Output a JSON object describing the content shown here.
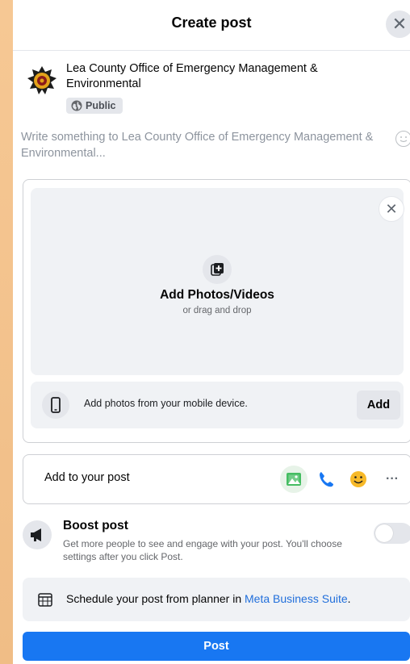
{
  "header": {
    "title": "Create post",
    "close_glyph": "✕"
  },
  "author": {
    "name": "Lea County Office of Emergency Management & Environmental",
    "privacy": "Public"
  },
  "composer": {
    "placeholder": "Write something to Lea County Office of Emergency Management & Environmental..."
  },
  "media": {
    "close_glyph": "✕",
    "title": "Add Photos/Videos",
    "subtitle": "or drag and drop",
    "mobile_text": "Add photos from your mobile device.",
    "add_label": "Add"
  },
  "add_to_post": {
    "label": "Add to your post",
    "more_glyph": "···",
    "tools": [
      "photo-video-icon",
      "phone-icon",
      "feeling-icon",
      "more-icon"
    ]
  },
  "boost": {
    "title": "Boost post",
    "description": "Get more people to see and engage with your post. You'll choose settings after you click Post.",
    "enabled": false
  },
  "schedule": {
    "text": "Schedule your post from planner in ",
    "link": "Meta Business Suite",
    "suffix": "."
  },
  "post_button": {
    "label": "Post"
  },
  "colors": {
    "primary": "#1877f2",
    "link": "#216fdb",
    "photo_green": "#45bd62",
    "feeling_yellow": "#f7b928",
    "background_frame": "#f3c592"
  }
}
